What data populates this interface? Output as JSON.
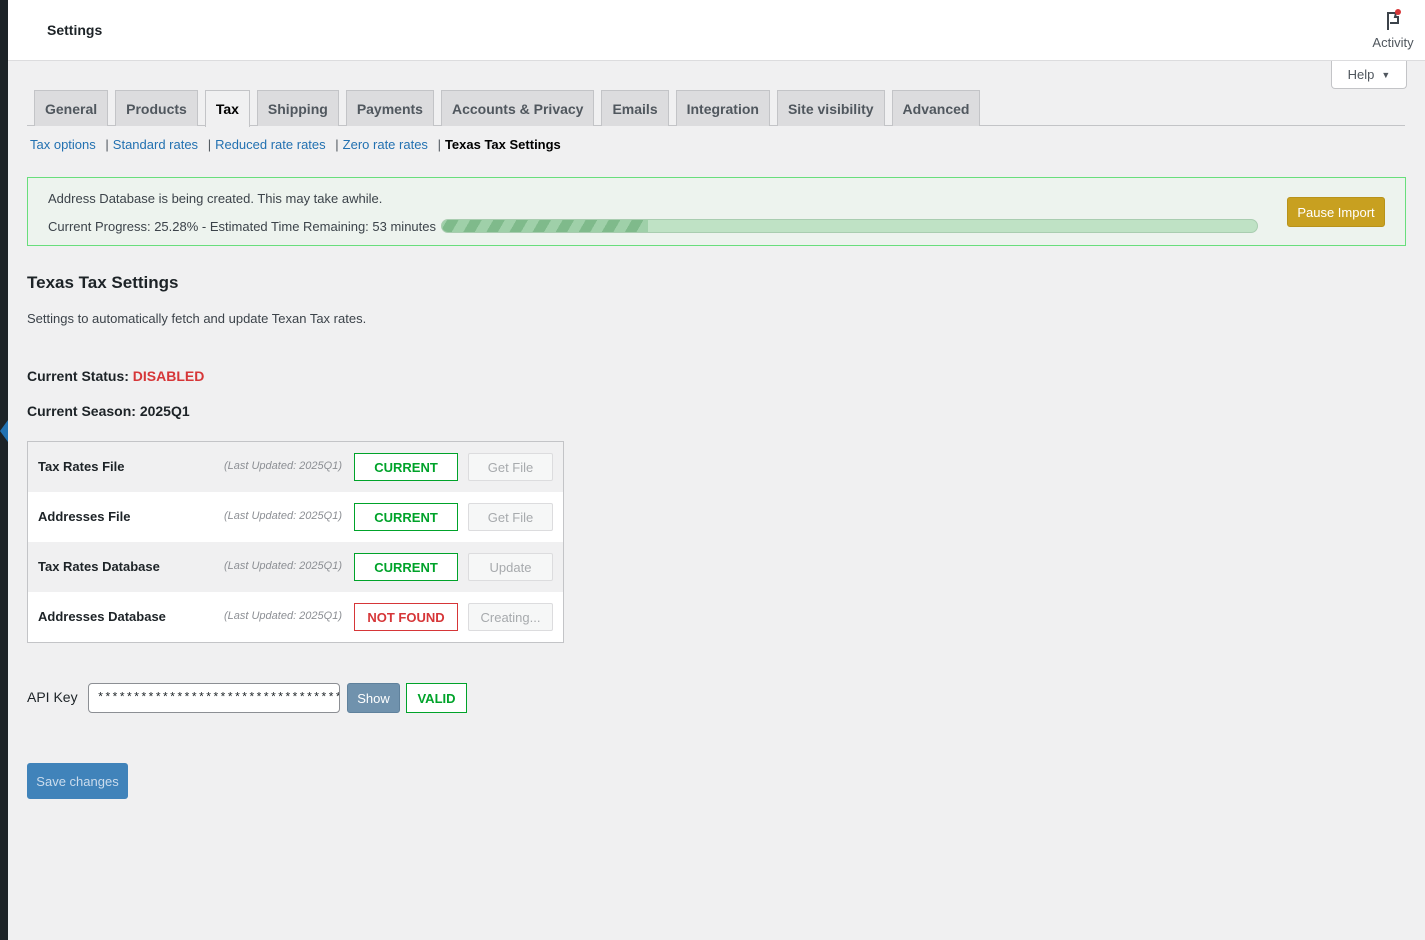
{
  "header": {
    "title": "Settings",
    "activity_label": "Activity",
    "help_label": "Help"
  },
  "tabs": [
    {
      "label": "General"
    },
    {
      "label": "Products"
    },
    {
      "label": "Tax"
    },
    {
      "label": "Shipping"
    },
    {
      "label": "Payments"
    },
    {
      "label": "Accounts & Privacy"
    },
    {
      "label": "Emails"
    },
    {
      "label": "Integration"
    },
    {
      "label": "Site visibility"
    },
    {
      "label": "Advanced"
    }
  ],
  "active_tab": "Tax",
  "sections": [
    {
      "label": "Tax options"
    },
    {
      "label": "Standard rates"
    },
    {
      "label": "Reduced rate rates"
    },
    {
      "label": "Zero rate rates"
    },
    {
      "label": "Texas Tax Settings"
    }
  ],
  "notice": {
    "message": "Address Database is being created. This may take awhile.",
    "progress_text": "Current Progress: 25.28% - Estimated Time Remaining: 53 minutes",
    "progress_percent": 25.28,
    "pause_label": "Pause Import"
  },
  "page": {
    "title": "Texas Tax Settings",
    "description": "Settings to automatically fetch and update Texan Tax rates.",
    "status_label": "Current Status:",
    "status_value": "DISABLED",
    "season_label": "Current Season:",
    "season_value": "2025Q1"
  },
  "files": [
    {
      "name": "Tax Rates File",
      "updated": "(Last Updated: 2025Q1)",
      "status": "CURRENT",
      "action": "Get File"
    },
    {
      "name": "Addresses File",
      "updated": "(Last Updated: 2025Q1)",
      "status": "CURRENT",
      "action": "Get File"
    },
    {
      "name": "Tax Rates Database",
      "updated": "(Last Updated: 2025Q1)",
      "status": "CURRENT",
      "action": "Update"
    },
    {
      "name": "Addresses Database",
      "updated": "(Last Updated: 2025Q1)",
      "status": "NOT FOUND",
      "action": "Creating..."
    }
  ],
  "api": {
    "label": "API Key",
    "value": "****************************************",
    "show_label": "Show",
    "valid_label": "VALID"
  },
  "save_label": "Save changes",
  "colors": {
    "accent": "#2271b1",
    "success": "#00a32a",
    "error": "#d63638",
    "pause_button": "#c8a020"
  }
}
